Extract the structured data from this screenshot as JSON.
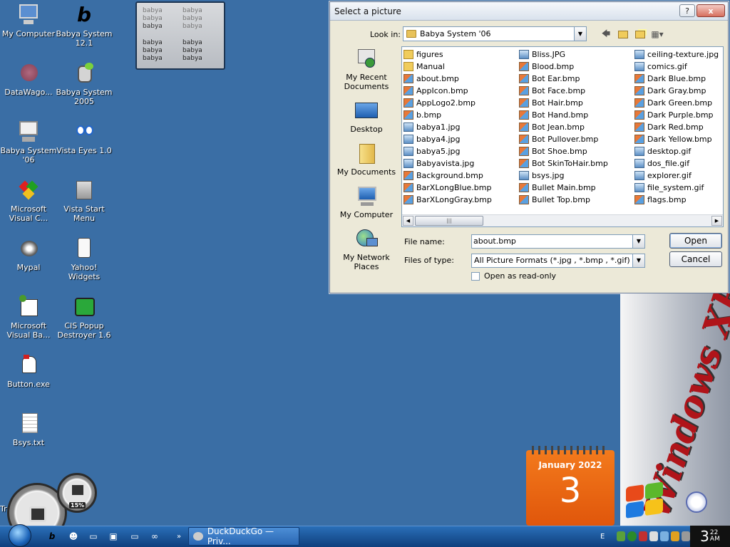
{
  "desktop": {
    "icons": [
      {
        "label": "My Computer",
        "icon": "my-computer-icon"
      },
      {
        "label": "Babya System 12.1",
        "icon": "babya-icon"
      },
      {
        "label": "DataWago...",
        "icon": "datawago-icon"
      },
      {
        "label": "Babya System 2005",
        "icon": "babya-bot-icon"
      },
      {
        "label": "Babya System '06",
        "icon": "babya-computer-icon"
      },
      {
        "label": "Vista Eyes 1.0",
        "icon": "eyes-icon"
      },
      {
        "label": "Microsoft Visual C...",
        "icon": "visual-c-icon"
      },
      {
        "label": "Vista Start Menu",
        "icon": "start-menu-icon"
      },
      {
        "label": "Mypal",
        "icon": "mypal-icon"
      },
      {
        "label": "Yahoo! Widgets",
        "icon": "yahoo-widgets-icon"
      },
      {
        "label": "Microsoft Visual Ba...",
        "icon": "visual-basic-icon"
      },
      {
        "label": "CIS Popup Destroyer 1.6",
        "icon": "popup-destroyer-icon"
      },
      {
        "label": "Button.exe",
        "icon": "button-exe-icon"
      },
      {
        "label": "Bsys.txt",
        "icon": "text-file-icon"
      },
      {
        "label": "Tr",
        "icon": "app-icon"
      }
    ]
  },
  "widget": {
    "rows_top": [
      [
        "babya",
        "babya"
      ],
      [
        "babya",
        "babya"
      ],
      [
        "babya",
        "babya"
      ]
    ],
    "rows_bottom": [
      [
        "babya",
        "babya"
      ],
      [
        "babya",
        "babya"
      ],
      [
        "babya",
        "babya"
      ]
    ]
  },
  "dialog": {
    "title": "Select a picture",
    "close_label": "x",
    "minimize_label": "?",
    "look_in_label": "Look in:",
    "look_in_value": "Babya System '06",
    "places": [
      {
        "label": "My Recent Documents",
        "icon": "recent-documents-icon"
      },
      {
        "label": "Desktop",
        "icon": "desktop-icon"
      },
      {
        "label": "My Documents",
        "icon": "my-documents-icon"
      },
      {
        "label": "My Computer",
        "icon": "my-computer-icon"
      },
      {
        "label": "My Network Places",
        "icon": "network-places-icon"
      }
    ],
    "files": [
      [
        {
          "name": "figures",
          "type": "folder"
        },
        {
          "name": "Manual",
          "type": "folder"
        },
        {
          "name": "about.bmp",
          "type": "bmp"
        },
        {
          "name": "AppIcon.bmp",
          "type": "bmp"
        },
        {
          "name": "AppLogo2.bmp",
          "type": "bmp"
        },
        {
          "name": "b.bmp",
          "type": "bmp"
        },
        {
          "name": "babya1.jpg",
          "type": "img"
        },
        {
          "name": "babya4.jpg",
          "type": "img"
        },
        {
          "name": "babya5.jpg",
          "type": "img"
        },
        {
          "name": "Babyavista.jpg",
          "type": "img"
        },
        {
          "name": "Background.bmp",
          "type": "bmp"
        },
        {
          "name": "BarXLongBlue.bmp",
          "type": "bmp"
        },
        {
          "name": "BarXLongGray.bmp",
          "type": "bmp"
        }
      ],
      [
        {
          "name": "Bliss.JPG",
          "type": "img"
        },
        {
          "name": "Blood.bmp",
          "type": "bmp"
        },
        {
          "name": "Bot Ear.bmp",
          "type": "bmp"
        },
        {
          "name": "Bot Face.bmp",
          "type": "bmp"
        },
        {
          "name": "Bot Hair.bmp",
          "type": "bmp"
        },
        {
          "name": "Bot Hand.bmp",
          "type": "bmp"
        },
        {
          "name": "Bot Jean.bmp",
          "type": "bmp"
        },
        {
          "name": "Bot Pullover.bmp",
          "type": "bmp"
        },
        {
          "name": "Bot Shoe.bmp",
          "type": "bmp"
        },
        {
          "name": "Bot SkinToHair.bmp",
          "type": "bmp"
        },
        {
          "name": "bsys.jpg",
          "type": "img"
        },
        {
          "name": "Bullet Main.bmp",
          "type": "bmp"
        },
        {
          "name": "Bullet Top.bmp",
          "type": "bmp"
        }
      ],
      [
        {
          "name": "ceiling-texture.jpg",
          "type": "img"
        },
        {
          "name": "comics.gif",
          "type": "img"
        },
        {
          "name": "Dark Blue.bmp",
          "type": "bmp"
        },
        {
          "name": "Dark Gray.bmp",
          "type": "bmp"
        },
        {
          "name": "Dark Green.bmp",
          "type": "bmp"
        },
        {
          "name": "Dark Purple.bmp",
          "type": "bmp"
        },
        {
          "name": "Dark Red.bmp",
          "type": "bmp"
        },
        {
          "name": "Dark Yellow.bmp",
          "type": "bmp"
        },
        {
          "name": "desktop.gif",
          "type": "img"
        },
        {
          "name": "dos_file.gif",
          "type": "img"
        },
        {
          "name": "explorer.gif",
          "type": "img"
        },
        {
          "name": "file_system.gif",
          "type": "img"
        },
        {
          "name": "flags.bmp",
          "type": "bmp"
        }
      ]
    ],
    "file_name_label": "File name:",
    "file_name_value": "about.bmp",
    "file_type_label": "Files of type:",
    "file_type_value": "All Picture Formats (*.jpg , *.bmp , *.gif)",
    "read_only_label": "Open as read-only",
    "open_label": "Open",
    "cancel_label": "Cancel"
  },
  "calendar": {
    "month": "January 2022",
    "day": "3"
  },
  "gauge": {
    "percent": "15%"
  },
  "banner": {
    "text": "Windows XP"
  },
  "taskbar": {
    "task_label": "DuckDuckGo — Priv...",
    "clock_hour": "3",
    "clock_min": "22",
    "clock_ampm": "AM",
    "tray_letter": "E"
  },
  "colors": {
    "desktop": "#3a6ea5",
    "calendar": "#f37a1c",
    "banner_text": "#b0141a"
  }
}
